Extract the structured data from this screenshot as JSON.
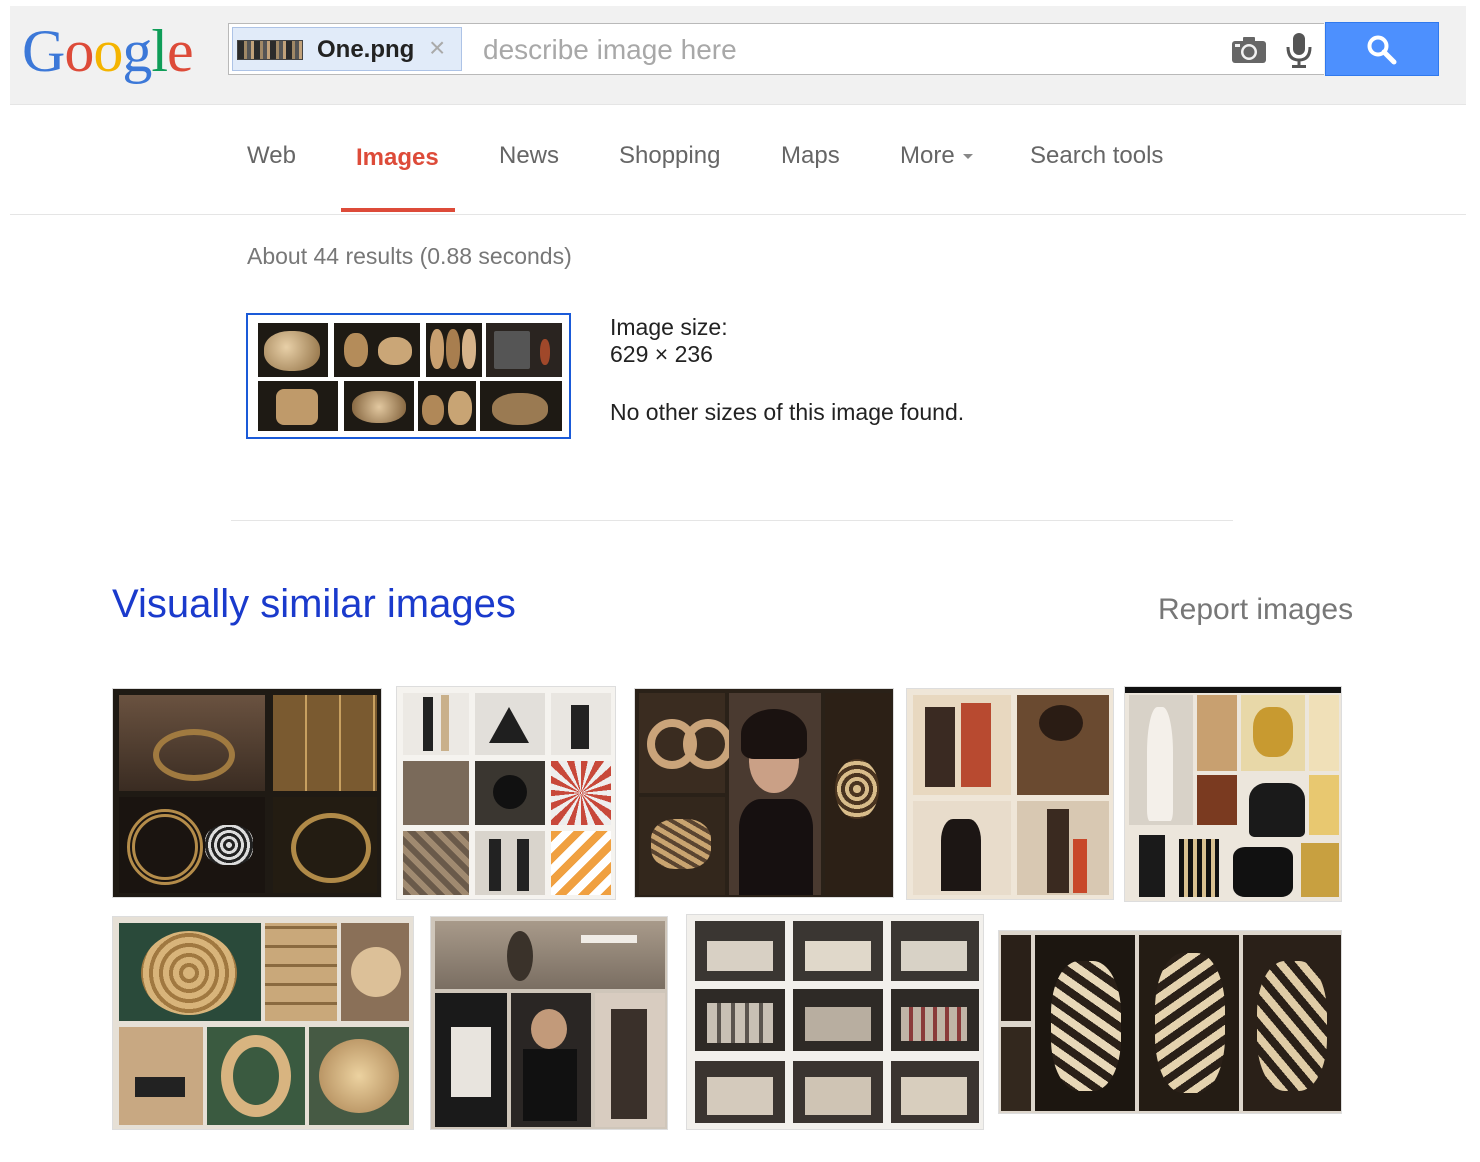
{
  "header": {
    "logo_letters": [
      {
        "char": "G",
        "color": "#3c78d8"
      },
      {
        "char": "o",
        "color": "#dd4b39"
      },
      {
        "char": "o",
        "color": "#f4b400"
      },
      {
        "char": "g",
        "color": "#3c78d8"
      },
      {
        "char": "l",
        "color": "#0f9d58"
      },
      {
        "char": "e",
        "color": "#dd4b39"
      }
    ],
    "file_chip": {
      "filename": "One.png",
      "close_glyph": "×"
    },
    "search_placeholder": "describe image here",
    "search_value": "",
    "icons": {
      "camera": "camera-icon",
      "mic": "microphone-icon",
      "search": "magnifier-icon"
    },
    "button_color": "#4d90fe"
  },
  "nav": {
    "tabs": [
      {
        "label": "Web",
        "active": false
      },
      {
        "label": "Images",
        "active": true
      },
      {
        "label": "News",
        "active": false
      },
      {
        "label": "Shopping",
        "active": false
      },
      {
        "label": "Maps",
        "active": false
      },
      {
        "label": "More",
        "active": false,
        "has_dropdown": true
      },
      {
        "label": "Search tools",
        "active": false
      }
    ],
    "active_color": "#dd4b39"
  },
  "results": {
    "stats": "About 44 results (0.88 seconds)",
    "image_size_label": "Image size:",
    "image_size_value": "629 × 236",
    "no_other_sizes": "No other sizes of this image found."
  },
  "similar": {
    "heading": "Visually similar images",
    "report_link": "Report images",
    "row1_count": 5,
    "row2_count": 4
  }
}
